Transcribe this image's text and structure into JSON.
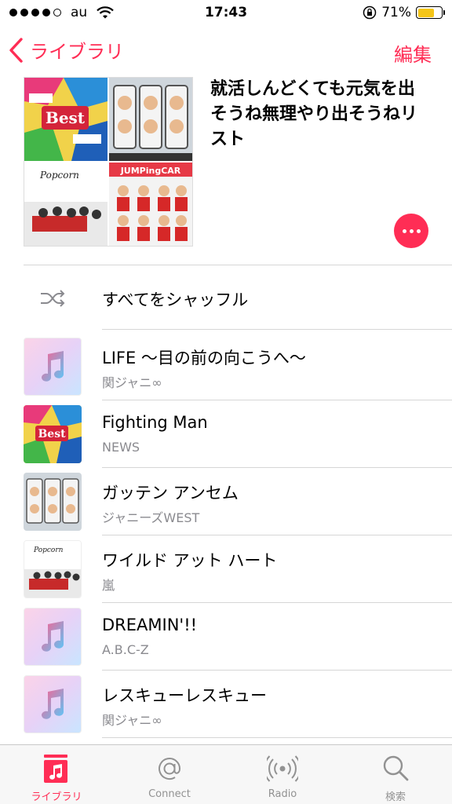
{
  "status": {
    "carrier": "au",
    "time": "17:43",
    "battery_text": "71%",
    "battery_level": 0.71
  },
  "nav": {
    "back_label": "ライブラリ",
    "edit_label": "編集"
  },
  "playlist": {
    "title": "就活しんどくても元気を出そうね無理やり出そうねリスト"
  },
  "shuffle": {
    "label": "すべてをシャッフル"
  },
  "tracks": [
    {
      "title": "LIFE 〜目の前の向こうへ〜",
      "artist": "関ジャニ∞",
      "artwork": "music-note-icon"
    },
    {
      "title": "Fighting Man",
      "artist": "NEWS",
      "artwork": "album-news-best"
    },
    {
      "title": "ガッテン アンセム",
      "artist": "ジャニーズWEST",
      "artwork": "album-jwest"
    },
    {
      "title": "ワイルド アット ハート",
      "artist": "嵐",
      "artwork": "album-popcorn"
    },
    {
      "title": "DREAMIN'!!",
      "artist": "A.B.C-Z",
      "artwork": "music-note-icon"
    },
    {
      "title": "レスキューレスキュー",
      "artist": "関ジャニ∞",
      "artwork": "music-note-icon"
    }
  ],
  "tabbar": {
    "items": [
      {
        "label": "ライブラリ",
        "icon": "library-icon",
        "active": true
      },
      {
        "label": "Connect",
        "icon": "at-icon",
        "active": false
      },
      {
        "label": "Radio",
        "icon": "radio-icon",
        "active": false
      },
      {
        "label": "検索",
        "icon": "search-icon",
        "active": false
      }
    ]
  },
  "colors": {
    "accent": "#ff2d55",
    "secondary_text": "#8a8a8f",
    "battery": "#f5c518"
  }
}
